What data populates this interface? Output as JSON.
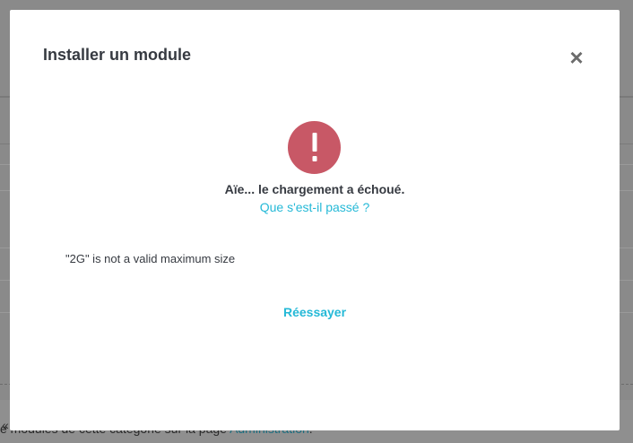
{
  "modal": {
    "title": "Installer un module",
    "close_icon": "close-icon",
    "error_icon": "exclamation-icon",
    "error_color": "#c85866",
    "error_heading": "Aïe... le chargement a échoué.",
    "what_happened_link": "Que s'est-il passé ?",
    "error_message": "\"2G\" is not a valid maximum size",
    "retry_label": "Réessayer",
    "link_color": "#25b9d7"
  },
  "background": {
    "quote_mark": "«",
    "footer_text_prefix": "e modules de cette catégorie sur la page ",
    "footer_link": "Administration",
    "footer_text_suffix": "."
  }
}
